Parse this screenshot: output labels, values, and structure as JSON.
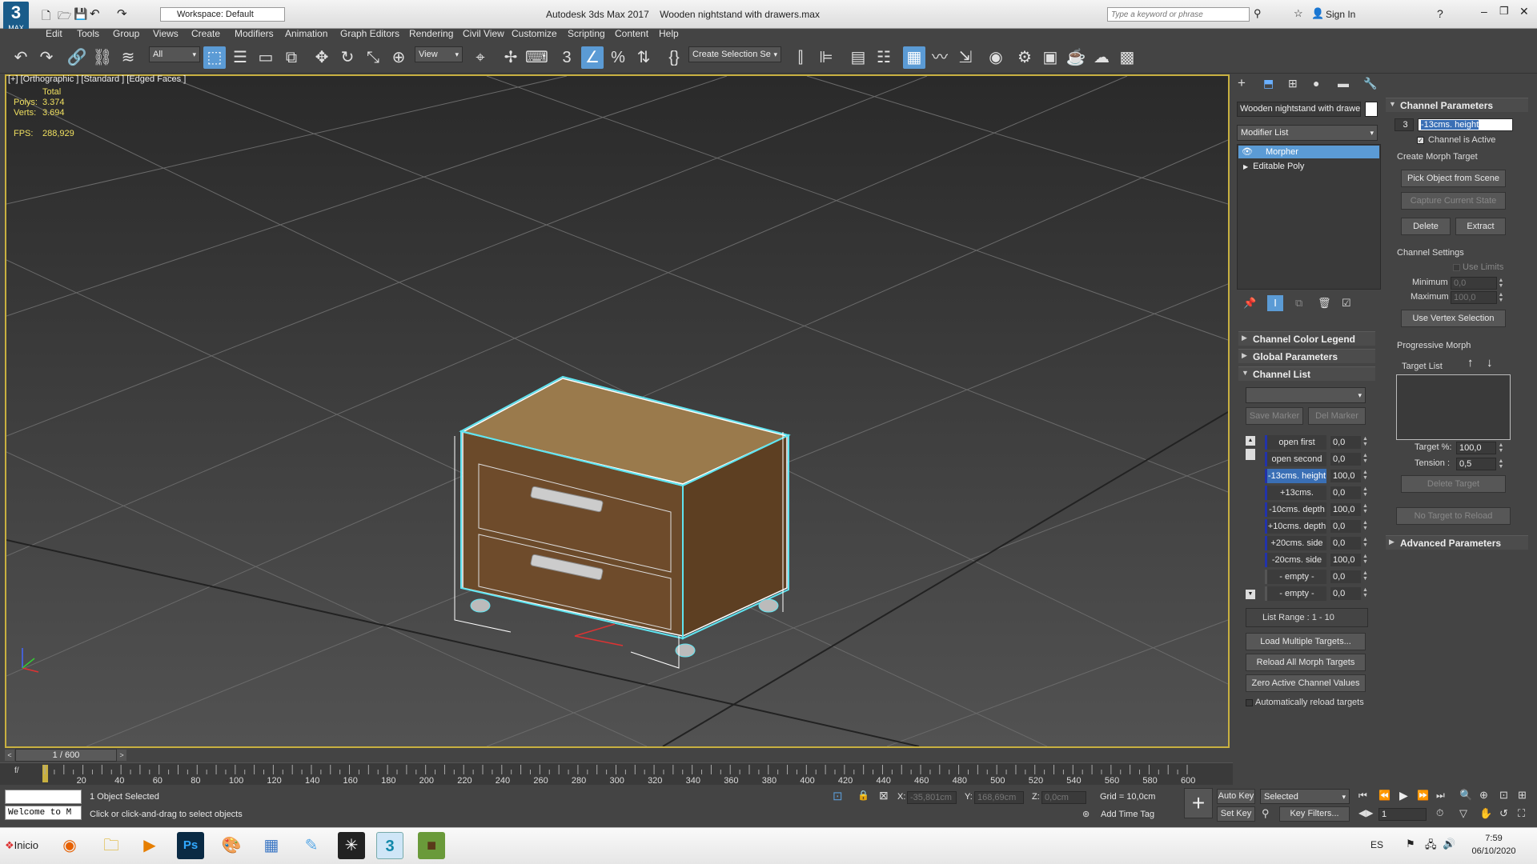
{
  "app": {
    "title": "Autodesk 3ds Max 2017",
    "file": "Wooden nightstand with drawers.max",
    "logo_label": "MAX",
    "workspace": "Workspace: Default",
    "search_placeholder": "Type a keyword or phrase",
    "sign_in": "Sign In"
  },
  "menu": [
    "Edit",
    "Tools",
    "Group",
    "Views",
    "Create",
    "Modifiers",
    "Animation",
    "Graph Editors",
    "Rendering",
    "Civil View",
    "Customize",
    "Scripting",
    "Content",
    "Help"
  ],
  "toolbar": {
    "filter": "All",
    "ref_coord": "View",
    "selection_set": "Create Selection Se"
  },
  "viewport": {
    "label": "[+] [Orthographic ] [Standard ] [Edged Faces ]",
    "stats": {
      "total_label": "Total",
      "polys_label": "Polys:",
      "polys": "3.374",
      "verts_label": "Verts:",
      "verts": "3.694",
      "fps_label": "FPS:",
      "fps": "288,929"
    }
  },
  "modify": {
    "object_name": "Wooden nightstand with drawers",
    "modifier_list": "Modifier List",
    "stack": [
      "Morpher",
      "Editable Poly"
    ]
  },
  "rollouts": {
    "color_legend": "Channel Color Legend",
    "global": "Global Parameters",
    "channel_list": "Channel List",
    "channel_params": "Channel Parameters",
    "advanced": "Advanced Parameters"
  },
  "channel_list": {
    "save_marker": "Save Marker",
    "del_marker": "Del Marker",
    "channels": [
      {
        "name": "open first",
        "value": "0,0"
      },
      {
        "name": "open second",
        "value": "0,0"
      },
      {
        "name": "-13cms. height",
        "value": "100,0",
        "selected": true
      },
      {
        "name": "+13cms. height",
        "value": "0,0"
      },
      {
        "name": "-10cms. depth",
        "value": "100,0"
      },
      {
        "name": "+10cms. depth",
        "value": "0,0"
      },
      {
        "name": "+20cms. side",
        "value": "0,0"
      },
      {
        "name": "-20cms. side",
        "value": "100,0"
      },
      {
        "name": "- empty -",
        "value": "0,0"
      },
      {
        "name": "- empty -",
        "value": "0,0"
      }
    ],
    "list_range": "List Range :    1 - 10",
    "load_multiple": "Load Multiple Targets...",
    "reload_all": "Reload All Morph Targets",
    "zero_active": "Zero Active Channel Values",
    "auto_reload": "Automatically reload targets"
  },
  "channel_params": {
    "number": "3",
    "name": "-13cms. height",
    "active": "Channel is Active",
    "create_hdr": "Create Morph Target",
    "pick": "Pick Object from Scene",
    "capture": "Capture Current State",
    "delete": "Delete",
    "extract": "Extract",
    "settings_hdr": "Channel Settings",
    "use_limits": "Use Limits",
    "minimum_label": "Minimum :",
    "minimum": "0,0",
    "maximum_label": "Maximum :",
    "maximum": "100,0",
    "vertex_sel": "Use Vertex Selection",
    "progressive_hdr": "Progressive Morph",
    "target_list": "Target List",
    "target_pct_label": "Target %:",
    "target_pct": "100,0",
    "tension_label": "Tension :",
    "tension": "0,5",
    "delete_target": "Delete Target",
    "no_target": "No Target to Reload"
  },
  "timeline": {
    "frame": "1 / 600",
    "ticks": [
      "20",
      "40",
      "60",
      "80",
      "100",
      "120",
      "140",
      "160",
      "180",
      "200",
      "220",
      "240",
      "260",
      "280",
      "300",
      "320",
      "340",
      "360",
      "380",
      "400",
      "420",
      "440",
      "460",
      "480",
      "500",
      "520",
      "540",
      "560",
      "580",
      "600"
    ],
    "start": "0"
  },
  "status": {
    "selected": "1 Object Selected",
    "prompt": "Click or click-and-drag to select objects",
    "maxscript": "Welcome to M",
    "x_label": "X:",
    "x": "-35,801cm",
    "y_label": "Y:",
    "y": "168,69cm",
    "z_label": "Z:",
    "z": "0,0cm",
    "grid": "Grid = 10,0cm",
    "add_time_tag": "Add Time Tag",
    "auto_key": "Auto Key",
    "set_key": "Set Key",
    "key_mode": "Selected",
    "key_filters": "Key Filters...",
    "current_frame": "1"
  },
  "taskbar": {
    "start": "Inicio",
    "lang": "ES",
    "time": "7:59",
    "date": "06/10/2020"
  }
}
